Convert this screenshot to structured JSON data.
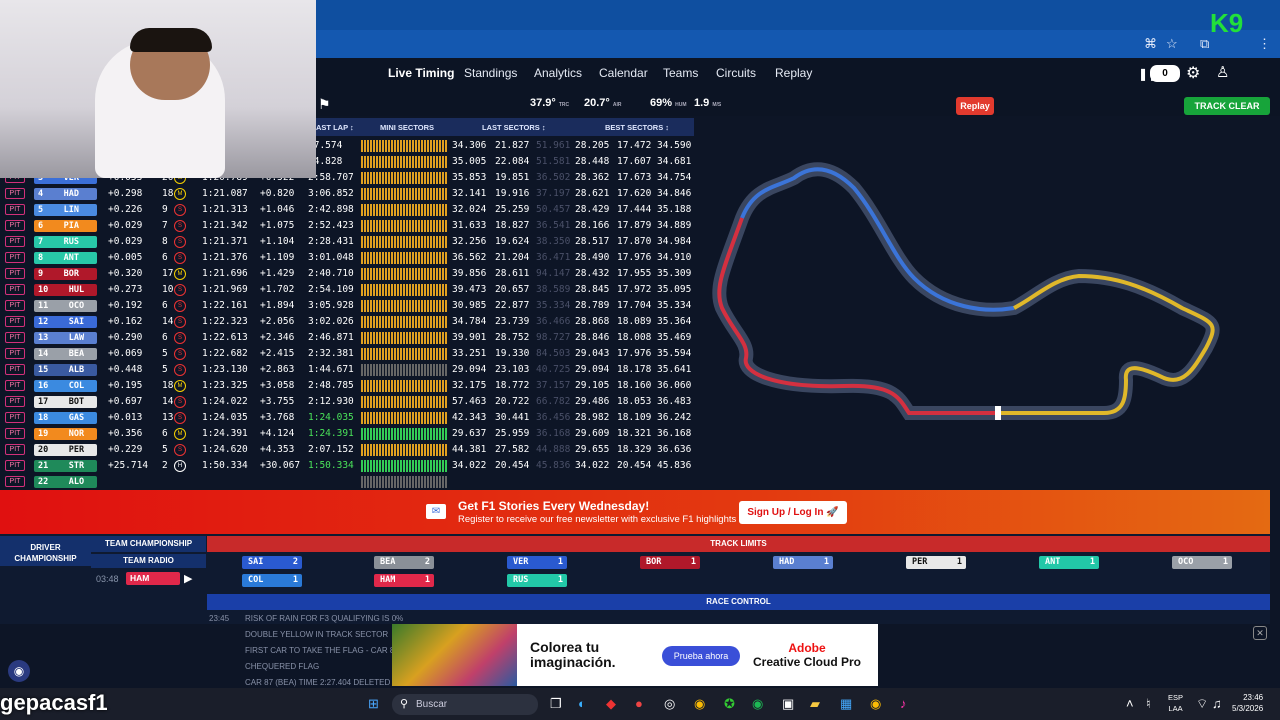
{
  "nav": {
    "tabs": [
      "Live Timing",
      "Standings",
      "Analytics",
      "Calendar",
      "Teams",
      "Circuits",
      "Replay"
    ],
    "counter": "0"
  },
  "weather": {
    "track_temp": "37.9°",
    "track_unit": "TRC",
    "air_temp": "20.7°",
    "air_unit": "AIR",
    "humidity": "69%",
    "hum_unit": "HUM",
    "wind": "1.9",
    "wind_unit": "M/S"
  },
  "replay_label": "Replay",
  "track_status": "TRACK CLEAR",
  "headers": {
    "last_lap": "AST LAP ↕",
    "mini": "MINI SECTORS",
    "last_sec": "LAST SECTORS ↕",
    "best_sec": "BEST SECTORS ↕"
  },
  "pit_label": "PIT",
  "rows": [
    {
      "pos": "",
      "drv": "",
      "gap": "",
      "laps": "",
      "tyre": "",
      "last": "",
      "delta": "",
      "laplast": "07.574",
      "s1": "34.306",
      "s2": "21.827",
      "s3": "51.961",
      "b1": "28.205",
      "b2": "17.472",
      "b3": "34.590",
      "color": "",
      "mini": "o"
    },
    {
      "pos": "",
      "drv": "",
      "gap": "",
      "laps": "",
      "tyre": "",
      "last": "",
      "delta": "",
      "laplast": "04.828",
      "s1": "35.005",
      "s2": "22.084",
      "s3": "51.581",
      "b1": "28.448",
      "b2": "17.607",
      "b3": "34.681",
      "color": "",
      "mini": "o"
    },
    {
      "pos": "3",
      "drv": "VER",
      "gap": "+0.053",
      "laps": "20",
      "tyre": "M",
      "last": "1:20.789",
      "delta": "+0.522",
      "laplast": "2:58.707",
      "s1": "35.853",
      "s2": "19.851",
      "s3": "36.502",
      "b1": "28.362",
      "b2": "17.673",
      "b3": "34.754",
      "color": "#3b6fd8",
      "mini": "o"
    },
    {
      "pos": "4",
      "drv": "HAD",
      "gap": "+0.298",
      "laps": "18",
      "tyre": "M",
      "last": "1:21.087",
      "delta": "+0.820",
      "laplast": "3:06.852",
      "s1": "32.141",
      "s2": "19.916",
      "s3": "37.197",
      "b1": "28.621",
      "b2": "17.620",
      "b3": "34.846",
      "color": "#5a7fd0",
      "mini": "o"
    },
    {
      "pos": "5",
      "drv": "LIN",
      "gap": "+0.226",
      "laps": "9",
      "tyre": "S",
      "last": "1:21.313",
      "delta": "+1.046",
      "laplast": "2:42.898",
      "s1": "32.024",
      "s2": "25.259",
      "s3": "50.457",
      "b1": "28.429",
      "b2": "17.444",
      "b3": "35.188",
      "color": "#4a8ae0",
      "mini": "o"
    },
    {
      "pos": "6",
      "drv": "PIA",
      "gap": "+0.029",
      "laps": "7",
      "tyre": "S",
      "last": "1:21.342",
      "delta": "+1.075",
      "laplast": "2:52.423",
      "s1": "31.633",
      "s2": "18.827",
      "s3": "36.541",
      "b1": "28.166",
      "b2": "17.879",
      "b3": "34.889",
      "color": "#f28a1e",
      "mini": "o"
    },
    {
      "pos": "7",
      "drv": "RUS",
      "gap": "+0.029",
      "laps": "8",
      "tyre": "S",
      "last": "1:21.371",
      "delta": "+1.104",
      "laplast": "2:28.431",
      "s1": "32.256",
      "s2": "19.624",
      "s3": "38.350",
      "b1": "28.517",
      "b2": "17.870",
      "b3": "34.984",
      "color": "#28c8a8",
      "mini": "o"
    },
    {
      "pos": "8",
      "drv": "ANT",
      "gap": "+0.005",
      "laps": "6",
      "tyre": "S",
      "last": "1:21.376",
      "delta": "+1.109",
      "laplast": "3:01.048",
      "s1": "36.562",
      "s2": "21.204",
      "s3": "36.471",
      "b1": "28.490",
      "b2": "17.976",
      "b3": "34.910",
      "color": "#28c8a8",
      "mini": "o"
    },
    {
      "pos": "9",
      "drv": "BOR",
      "gap": "+0.320",
      "laps": "17",
      "tyre": "M",
      "last": "1:21.696",
      "delta": "+1.429",
      "laplast": "2:40.710",
      "s1": "39.856",
      "s2": "28.611",
      "s3": "94.147",
      "b1": "28.432",
      "b2": "17.955",
      "b3": "35.309",
      "color": "#b0182a",
      "mini": "o"
    },
    {
      "pos": "10",
      "drv": "HUL",
      "gap": "+0.273",
      "laps": "10",
      "tyre": "S",
      "last": "1:21.969",
      "delta": "+1.702",
      "laplast": "2:54.109",
      "s1": "39.473",
      "s2": "20.657",
      "s3": "38.589",
      "b1": "28.845",
      "b2": "17.972",
      "b3": "35.095",
      "color": "#b0182a",
      "mini": "o"
    },
    {
      "pos": "11",
      "drv": "OCO",
      "gap": "+0.192",
      "laps": "6",
      "tyre": "S",
      "last": "1:22.161",
      "delta": "+1.894",
      "laplast": "3:05.928",
      "s1": "30.985",
      "s2": "22.877",
      "s3": "35.334",
      "b1": "28.789",
      "b2": "17.704",
      "b3": "35.334",
      "color": "#9aa0a8",
      "mini": "o"
    },
    {
      "pos": "12",
      "drv": "SAI",
      "gap": "+0.162",
      "laps": "14",
      "tyre": "S",
      "last": "1:22.323",
      "delta": "+2.056",
      "laplast": "3:02.026",
      "s1": "34.784",
      "s2": "23.739",
      "s3": "36.466",
      "b1": "28.868",
      "b2": "18.089",
      "b3": "35.364",
      "color": "#3a6ad8",
      "mini": "o"
    },
    {
      "pos": "13",
      "drv": "LAW",
      "gap": "+0.290",
      "laps": "6",
      "tyre": "S",
      "last": "1:22.613",
      "delta": "+2.346",
      "laplast": "2:46.871",
      "s1": "39.901",
      "s2": "28.752",
      "s3": "98.727",
      "b1": "28.846",
      "b2": "18.008",
      "b3": "35.469",
      "color": "#5a7fd0",
      "mini": "o"
    },
    {
      "pos": "14",
      "drv": "BEA",
      "gap": "+0.069",
      "laps": "5",
      "tyre": "S",
      "last": "1:22.682",
      "delta": "+2.415",
      "laplast": "2:32.381",
      "s1": "33.251",
      "s2": "19.330",
      "s3": "84.503",
      "b1": "29.043",
      "b2": "17.976",
      "b3": "35.594",
      "color": "#9aa0a8",
      "mini": "o"
    },
    {
      "pos": "15",
      "drv": "ALB",
      "gap": "+0.448",
      "laps": "5",
      "tyre": "S",
      "last": "1:23.130",
      "delta": "+2.863",
      "laplast": "1:44.671",
      "s1": "29.094",
      "s2": "23.103",
      "s3": "40.725",
      "b1": "29.094",
      "b2": "18.178",
      "b3": "35.641",
      "color": "#3a5aa0",
      "mini": "x"
    },
    {
      "pos": "16",
      "drv": "COL",
      "gap": "+0.195",
      "laps": "18",
      "tyre": "M",
      "last": "1:23.325",
      "delta": "+3.058",
      "laplast": "2:48.785",
      "s1": "32.175",
      "s2": "18.772",
      "s3": "37.157",
      "b1": "29.105",
      "b2": "18.160",
      "b3": "36.060",
      "color": "#3b8ae0",
      "mini": "o"
    },
    {
      "pos": "17",
      "drv": "BOT",
      "gap": "+0.697",
      "laps": "14",
      "tyre": "S",
      "last": "1:24.022",
      "delta": "+3.755",
      "laplast": "2:12.930",
      "s1": "57.463",
      "s2": "20.722",
      "s3": "66.782",
      "b1": "29.486",
      "b2": "18.053",
      "b3": "36.483",
      "color": "#e8e8e8",
      "mini": "o"
    },
    {
      "pos": "18",
      "drv": "GAS",
      "gap": "+0.013",
      "laps": "13",
      "tyre": "S",
      "last": "1:24.035",
      "delta": "+3.768",
      "laplast": "1:24.035",
      "s1": "42.343",
      "s2": "30.441",
      "s3": "36.456",
      "b1": "28.982",
      "b2": "18.109",
      "b3": "36.242",
      "color": "#3b8ae0",
      "mini": "o"
    },
    {
      "pos": "19",
      "drv": "NOR",
      "gap": "+0.356",
      "laps": "6",
      "tyre": "M",
      "last": "1:24.391",
      "delta": "+4.124",
      "laplast": "1:24.391",
      "s1": "29.637",
      "s2": "25.959",
      "s3": "36.168",
      "b1": "29.609",
      "b2": "18.321",
      "b3": "36.168",
      "color": "#f28a1e",
      "mini": "g"
    },
    {
      "pos": "20",
      "drv": "PER",
      "gap": "+0.229",
      "laps": "5",
      "tyre": "S",
      "last": "1:24.620",
      "delta": "+4.353",
      "laplast": "2:07.152",
      "s1": "44.381",
      "s2": "27.582",
      "s3": "44.888",
      "b1": "29.655",
      "b2": "18.329",
      "b3": "36.636",
      "color": "#e8e8e8",
      "mini": "o"
    },
    {
      "pos": "21",
      "drv": "STR",
      "gap": "+25.714",
      "laps": "2",
      "tyre": "H",
      "last": "1:50.334",
      "delta": "+30.067",
      "laplast": "1:50.334",
      "s1": "34.022",
      "s2": "20.454",
      "s3": "45.836",
      "b1": "34.022",
      "b2": "20.454",
      "b3": "45.836",
      "color": "#1f8a5a",
      "mini": "g"
    },
    {
      "pos": "22",
      "drv": "ALO",
      "gap": "",
      "laps": "",
      "tyre": "",
      "last": "",
      "delta": "",
      "laplast": "",
      "s1": "",
      "s2": "",
      "s3": "",
      "b1": "",
      "b2": "",
      "b3": "",
      "color": "#1f8a5a",
      "mini": "x"
    }
  ],
  "banner": {
    "title": "Get F1 Stories Every Wednesday!",
    "subtitle": "Register to receive our free newsletter with exclusive F1 highlights",
    "signup": "Sign Up / Log In 🚀"
  },
  "bottom": {
    "driver_champ": "DRIVER CHAMPIONSHIP",
    "team_champ": "TEAM CHAMPIONSHIP",
    "team_radio": "TEAM RADIO",
    "radio_time": "03:48",
    "radio_driver": "HAM",
    "track_limits": "TRACK LIMITS",
    "race_control": "RACE CONTROL"
  },
  "track_limits": [
    {
      "drv": "SAI",
      "n": "2",
      "color": "#2a5ad0"
    },
    {
      "drv": "COL",
      "n": "1",
      "color": "#2a7ad8"
    },
    {
      "drv": "BEA",
      "n": "2",
      "color": "#8a9098"
    },
    {
      "drv": "HAM",
      "n": "1",
      "color": "#e0284a"
    },
    {
      "drv": "VER",
      "n": "1",
      "color": "#2a5ad0"
    },
    {
      "drv": "RUS",
      "n": "1",
      "color": "#22c8a8"
    },
    {
      "drv": "BOR",
      "n": "1",
      "color": "#b0182a"
    },
    {
      "drv": "HAD",
      "n": "1",
      "color": "#5a7fd0"
    },
    {
      "drv": "PER",
      "n": "1",
      "color": "#e8e8e8"
    },
    {
      "drv": "ANT",
      "n": "1",
      "color": "#22c8a8"
    },
    {
      "drv": "OCO",
      "n": "1",
      "color": "#9aa0a8"
    }
  ],
  "race_control": [
    {
      "time": "23:45",
      "msg": "RISK OF RAIN FOR F3 QUALIFYING IS 0%"
    },
    {
      "time": "",
      "msg": "DOUBLE YELLOW IN TRACK SECTOR"
    },
    {
      "time": "",
      "msg": "FIRST CAR TO TAKE THE FLAG - CAR 87 (BEA)"
    },
    {
      "time": "",
      "msg": "CHEQUERED FLAG"
    },
    {
      "time": "",
      "msg": "CAR 87 (BEA) TIME 2:27.404 DELETED - TRACK LIMITS"
    }
  ],
  "ad": {
    "headline": "Colorea tu imaginación.",
    "button": "Prueba ahora",
    "brand_top": "Adobe",
    "brand_bottom": "Creative Cloud Pro"
  },
  "taskbar": {
    "search": "Buscar",
    "lang_top": "ESP",
    "lang_bottom": "LAA",
    "time": "23:46",
    "date": "5/3/2026"
  },
  "watermark": "gepacasf1",
  "k9": "9"
}
